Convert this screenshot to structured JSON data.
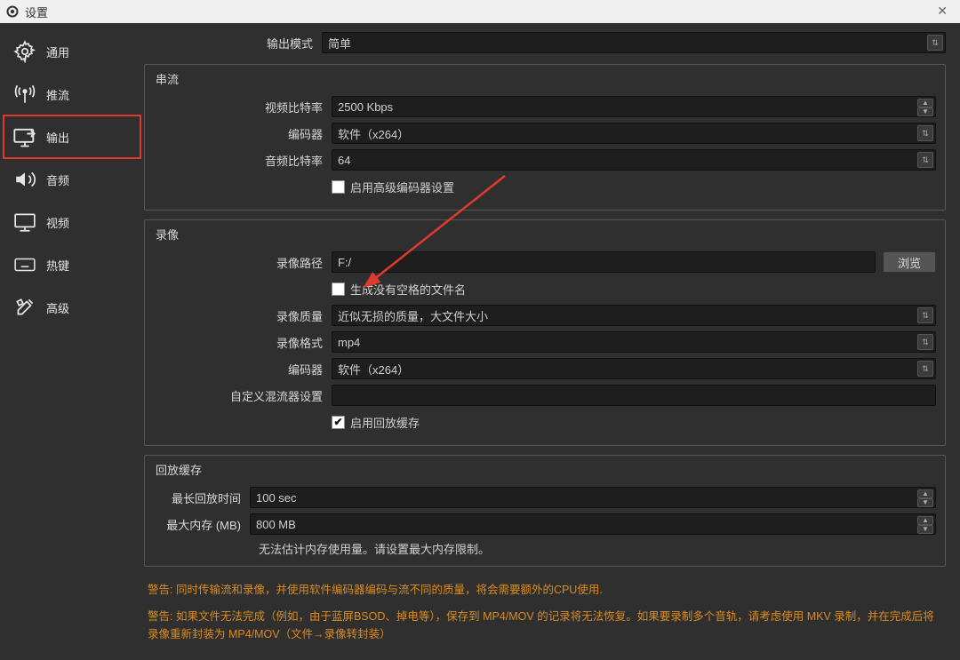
{
  "window": {
    "title": "设置"
  },
  "sidebar": {
    "items": [
      {
        "label": "通用"
      },
      {
        "label": "推流"
      },
      {
        "label": "输出"
      },
      {
        "label": "音频"
      },
      {
        "label": "视频"
      },
      {
        "label": "热键"
      },
      {
        "label": "高级"
      }
    ]
  },
  "output_mode": {
    "label": "输出模式",
    "value": "简单"
  },
  "streaming": {
    "legend": "串流",
    "video_bitrate_label": "视频比特率",
    "video_bitrate_value": "2500 Kbps",
    "encoder_label": "编码器",
    "encoder_value": "软件（x264）",
    "audio_bitrate_label": "音频比特率",
    "audio_bitrate_value": "64",
    "advanced_encoder_label": "启用高级编码器设置"
  },
  "recording": {
    "legend": "录像",
    "path_label": "录像路径",
    "path_value": "F:/",
    "browse_label": "浏览",
    "no_space_label": "生成没有空格的文件名",
    "quality_label": "录像质量",
    "quality_value": "近似无损的质量，大文件大小",
    "format_label": "录像格式",
    "format_value": "mp4",
    "encoder_label": "编码器",
    "encoder_value": "软件（x264）",
    "muxer_label": "自定义混流器设置",
    "replay_buffer_label": "启用回放缓存"
  },
  "replay": {
    "legend": "回放缓存",
    "max_time_label": "最长回放时间",
    "max_time_value": "100 sec",
    "max_mem_label": "最大内存 (MB)",
    "max_mem_value": "800 MB",
    "memo": "无法估计内存使用量。请设置最大内存限制。"
  },
  "warnings": {
    "w1": "警告: 同时传输流和录像，并使用软件编码器编码与流不同的质量，将会需要额外的CPU使用.",
    "w2": "警告: 如果文件无法完成（例如，由于蓝屏BSOD、掉电等），保存到 MP4/MOV 的记录将无法恢复。如果要录制多个音轨，请考虑使用 MKV 录制，并在完成后将录像重新封装为 MP4/MOV（文件→录像转封装）"
  }
}
